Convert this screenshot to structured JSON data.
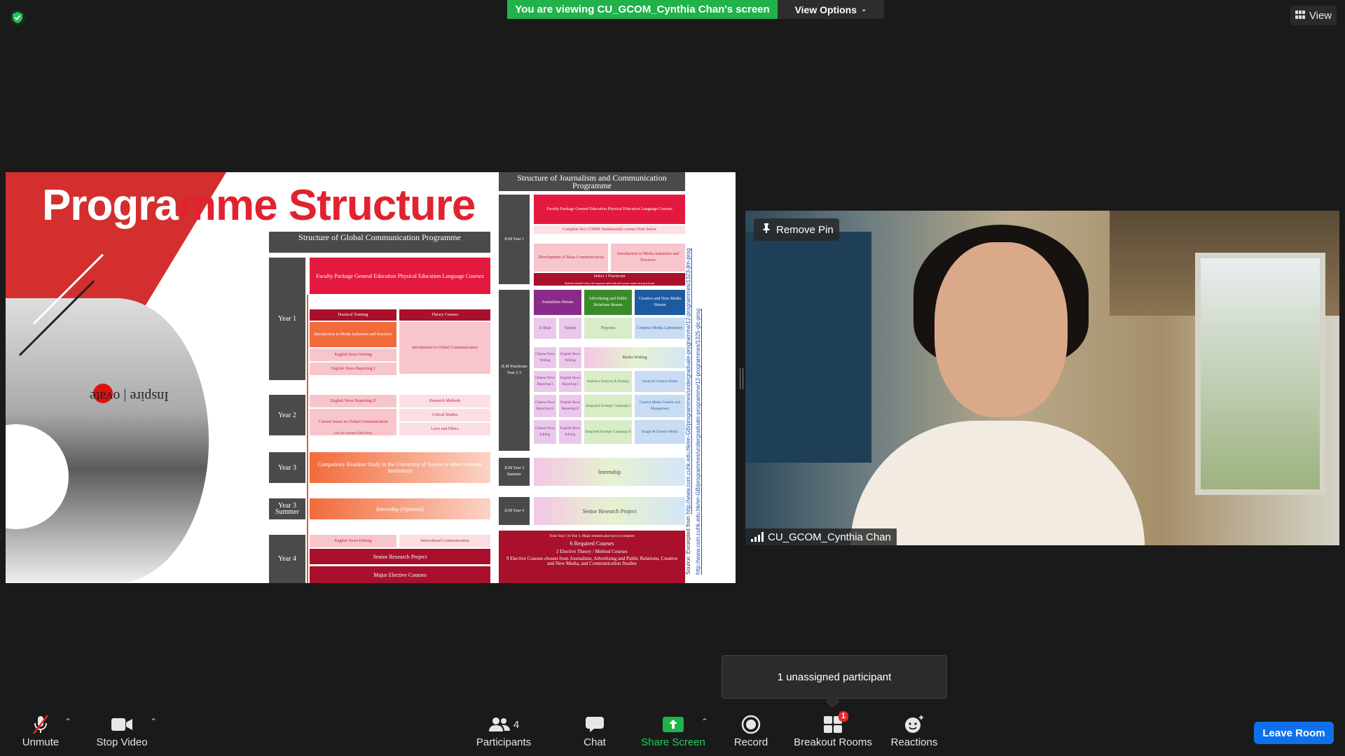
{
  "top": {
    "viewing_banner": "You are viewing CU_GCOM_Cynthia Chan's screen",
    "view_options": "View Options",
    "view_button": "View"
  },
  "slide": {
    "title_part1": "Progra",
    "title_part2": "mme Structure",
    "sign_text": "Inspire | ovate",
    "gcp": {
      "header": "Structure of Global Communication Programme",
      "year1_label": "Year 1",
      "faculty_package": "Faculty Package General Education Physical Education Language Courses",
      "practical_training": "Practical Training",
      "theory_courses": "Theory Courses",
      "intro_media": "Introduction to Media Industries and Practices",
      "intro_global": "Introduction to Global Communication",
      "english_news_writing": "English News Writing",
      "english_news_reporting_1": "English News Reporting I",
      "year2_label": "Year 2",
      "english_news_reporting_2": "English News Reporting II",
      "research_methods": "Research Methods",
      "current_issues": "Current Issues in Global Communication",
      "current_issues_note": "with an overseas field study",
      "critical_studies": "Critical Studies",
      "laws_ethics": "Laws and Ethics",
      "year3_label": "Year 3",
      "compulsory_resident": "Compulsory Resident Study in the University of Sussex or other overseas institutions",
      "year3_summer_label": "Year 3 Summer",
      "internship_optional": "Internship (Optional)",
      "year4_label": "Year 4",
      "english_news_editing": "English News Editing",
      "intercultural": "Intercultural Communication",
      "senior_research": "Senior Research Project",
      "major_elective": "Major Elective Courses"
    },
    "jcp": {
      "header": "Structure of Journalism and Communication Programme",
      "y1_label": "JLM Year 1",
      "faculty_package": "Faculty Package General Education Physical Education Language Courses",
      "complete_two": "Complete two COMM fundamental courses from below",
      "dev_mass": "Development of Mass Communication",
      "intro_media": "Introduction to Media Industries and Practices",
      "select_practicum": "Select 1 Practicum",
      "practicum_note": "Students should follow the sequence and study all courses under each practicum",
      "y23_label": "JLM Practicum Year 2-3",
      "journalism_stream": "Journalism Stream",
      "adpr_stream": "Advertising and Public Relations Stream",
      "cnm_stream": "Creative and New Media Stream",
      "ubeat": "U-Beat",
      "varsity": "Varsity",
      "pinpoint": "Pinpoint",
      "cml": "Creative Media Laboratory",
      "chinese_writing": "Chinese News Writing",
      "english_writing": "English News Writing",
      "media_writing": "Media Writing",
      "chinese_reporting": "Chinese News Reporting I",
      "english_reporting": "English News Reporting I",
      "audience": "Audience Analysis & Strategy",
      "sound": "Sound & Creative Media",
      "chinese_reporting2": "Chinese News Reporting II",
      "english_reporting2": "English News Reporting II",
      "isc1": "Integrated Strategic Campaign I",
      "cmcm": "Creative Media Curation and Management",
      "chinese_editing": "Chinese News Editing",
      "english_editing": "English News Editing",
      "isc2": "Integrated Strategic Campaign II",
      "images": "Images & Creative Media",
      "y3s_label": "JLM Year 3 Summer",
      "internship": "Internship",
      "y4_label": "JLM Year 4",
      "senior_research": "Senior Research Project",
      "bottom_note": "From Year 1 to Year 4, Major students also have to complete",
      "req6": "6 Required Courses",
      "elective2": "2 Elective Theory / Method Courses",
      "elective9": "9 Elective Courses chosen from Journalism, Advertising and Public Relations, Creative and New Media, and Communication Studies"
    },
    "source_label": "Source: Excerpted from",
    "source_url1": "http://www.com.cuhk.edu.hk/en-GB/programmes/undergraduate-programme/12-programmes/1323-jlm-prog",
    "source_url2": "http://www.com.cuhk.edu.hk/en-GB/programmes/undergraduate-programme/12-programmes/1325-glc-prog"
  },
  "video": {
    "remove_pin": "Remove Pin",
    "participant_name": "CU_GCOM_Cynthia Chan"
  },
  "tooltip": {
    "text": "1 unassigned participant"
  },
  "toolbar": {
    "unmute": "Unmute",
    "stop_video": "Stop Video",
    "participants": "Participants",
    "participants_count": "4",
    "chat": "Chat",
    "share_screen": "Share Screen",
    "record": "Record",
    "breakout_rooms": "Breakout Rooms",
    "breakout_badge": "1",
    "reactions": "Reactions",
    "leave_room": "Leave Room"
  },
  "colors": {
    "share_green": "#21b24b",
    "leave_blue": "#0e71eb",
    "slide_red": "#e2222f"
  }
}
